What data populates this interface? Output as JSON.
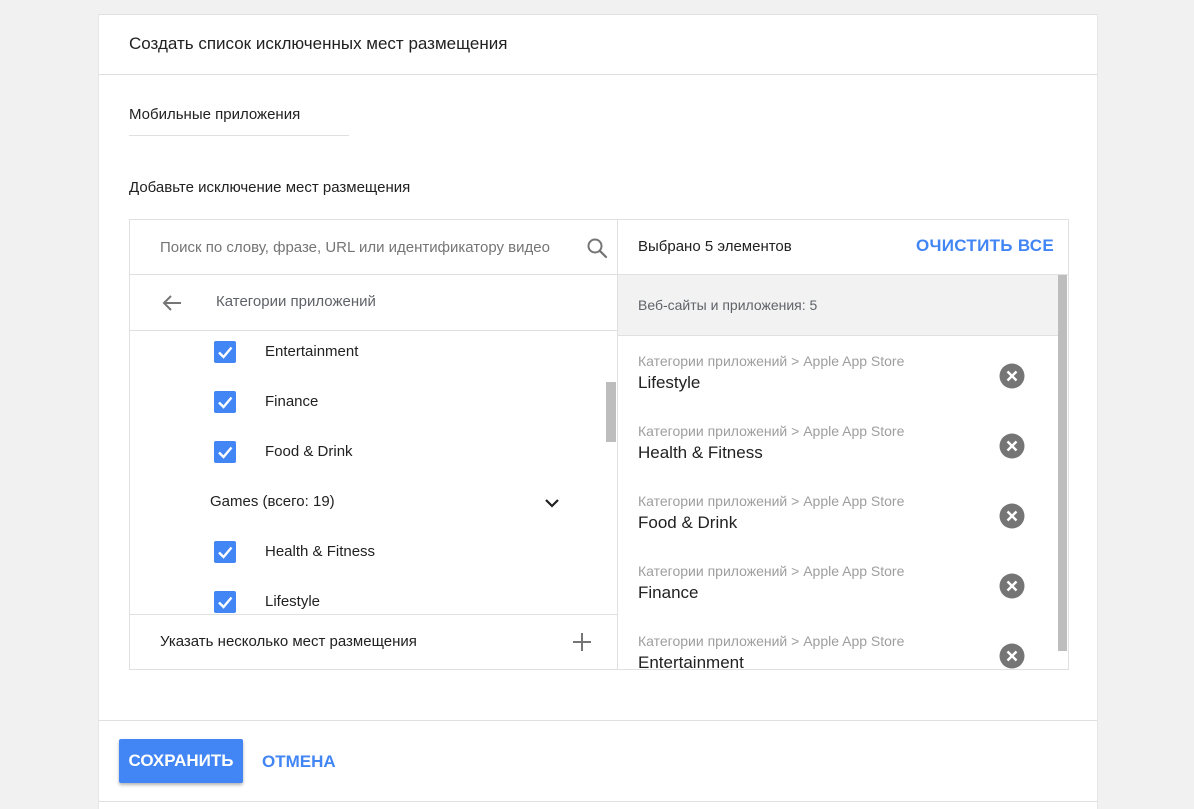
{
  "dialog": {
    "title": "Создать список исключенных мест размещения",
    "list_name": "Мобильные приложения",
    "section_label": "Добавьте исключение мест размещения"
  },
  "search": {
    "placeholder": "Поиск по слову, фразе, URL или идентификатору видео",
    "icon": "search-icon"
  },
  "browser": {
    "back_icon": "arrow-back-icon",
    "category_title": "Категории приложений",
    "items": [
      {
        "label": "Entertainment",
        "checked": true
      },
      {
        "label": "Finance",
        "checked": true
      },
      {
        "label": "Food & Drink",
        "checked": true
      },
      {
        "label": "Games (всего: 19)",
        "group": true,
        "icon": "chevron-down-icon"
      },
      {
        "label": "Health & Fitness",
        "checked": true
      },
      {
        "label": "Lifestyle",
        "checked": true
      }
    ],
    "multi_label": "Указать несколько мест размещения",
    "multi_icon": "plus-icon"
  },
  "selection": {
    "count_label": "Выбрано 5 элементов",
    "clear_all": "ОЧИСТИТЬ ВСЕ",
    "group_header": "Веб-сайты и приложения: 5",
    "items": [
      {
        "path": "Категории приложений > Apple App Store",
        "name": "Lifestyle"
      },
      {
        "path": "Категории приложений > Apple App Store",
        "name": "Health & Fitness"
      },
      {
        "path": "Категории приложений > Apple App Store",
        "name": "Food & Drink"
      },
      {
        "path": "Категории приложений > Apple App Store",
        "name": "Finance"
      },
      {
        "path": "Категории приложений > Apple App Store",
        "name": "Entertainment"
      }
    ],
    "remove_icon": "remove-circle-icon"
  },
  "footer": {
    "save": "СОХРАНИТЬ",
    "cancel": "ОТМЕНА"
  },
  "colors": {
    "accent": "#4285f4",
    "background": "#f1f1f1",
    "group_header_bg": "#f2f2f2"
  }
}
